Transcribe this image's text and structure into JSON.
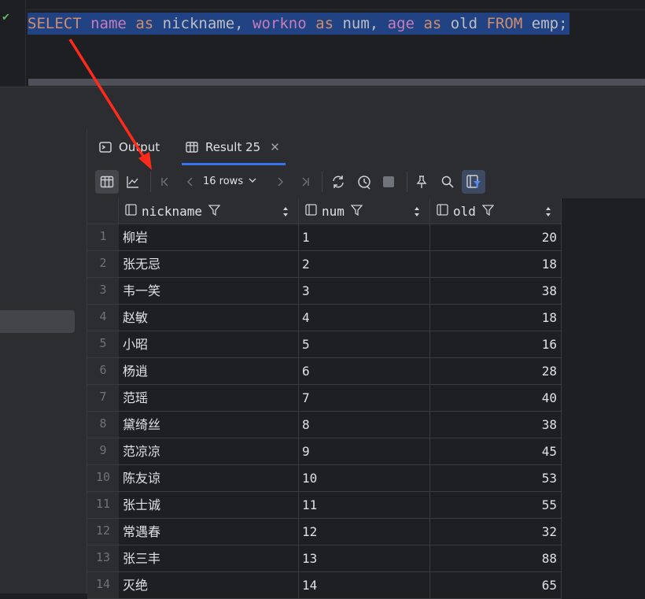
{
  "editor": {
    "sql_tokens": [
      {
        "text": "SELECT",
        "kind": "keyword"
      },
      {
        "text": " ",
        "kind": "plain"
      },
      {
        "text": "name",
        "kind": "field"
      },
      {
        "text": " ",
        "kind": "plain"
      },
      {
        "text": "as",
        "kind": "keyword"
      },
      {
        "text": " nickname, ",
        "kind": "plain"
      },
      {
        "text": "workno",
        "kind": "field"
      },
      {
        "text": " ",
        "kind": "plain"
      },
      {
        "text": "as",
        "kind": "keyword"
      },
      {
        "text": " num, ",
        "kind": "plain"
      },
      {
        "text": "age",
        "kind": "field"
      },
      {
        "text": " ",
        "kind": "plain"
      },
      {
        "text": "as",
        "kind": "keyword"
      },
      {
        "text": " old ",
        "kind": "plain"
      },
      {
        "text": "FROM",
        "kind": "keyword"
      },
      {
        "text": " emp;",
        "kind": "plain"
      }
    ],
    "status_icon": "checkmark-icon"
  },
  "tabs": [
    {
      "label": "Output",
      "icon": "console-icon"
    },
    {
      "label": "Result 25",
      "icon": "table-icon",
      "active": true
    }
  ],
  "toolbar": {
    "rows_label": "16 rows",
    "icons": [
      "table-view-icon",
      "chart-view-icon",
      "first-page-icon",
      "prev-page-icon",
      "next-page-icon",
      "last-page-icon",
      "refresh-icon",
      "history-icon",
      "stop-icon",
      "pin-icon",
      "search-icon",
      "filter-panel-icon"
    ]
  },
  "grid": {
    "columns": [
      "nickname",
      "num",
      "old"
    ],
    "rows": [
      [
        "1",
        "柳岩",
        "1",
        "20"
      ],
      [
        "2",
        "张无忌",
        "2",
        "18"
      ],
      [
        "3",
        "韦一笑",
        "3",
        "38"
      ],
      [
        "4",
        "赵敏",
        "4",
        "18"
      ],
      [
        "5",
        "小昭",
        "5",
        "16"
      ],
      [
        "6",
        "杨逍",
        "6",
        "28"
      ],
      [
        "7",
        "范瑶",
        "7",
        "40"
      ],
      [
        "8",
        "黛绮丝",
        "8",
        "38"
      ],
      [
        "9",
        "范凉凉",
        "9",
        "45"
      ],
      [
        "10",
        "陈友谅",
        "10",
        "53"
      ],
      [
        "11",
        "张士诚",
        "11",
        "55"
      ],
      [
        "12",
        "常遇春",
        "12",
        "32"
      ],
      [
        "13",
        "张三丰",
        "13",
        "88"
      ],
      [
        "14",
        "灭绝",
        "14",
        "65"
      ]
    ]
  },
  "colors": {
    "keyword": "#cf8e6d",
    "field": "#c77dbb",
    "selection": "#214283",
    "annotation_arrow": "#ff2a1a"
  }
}
